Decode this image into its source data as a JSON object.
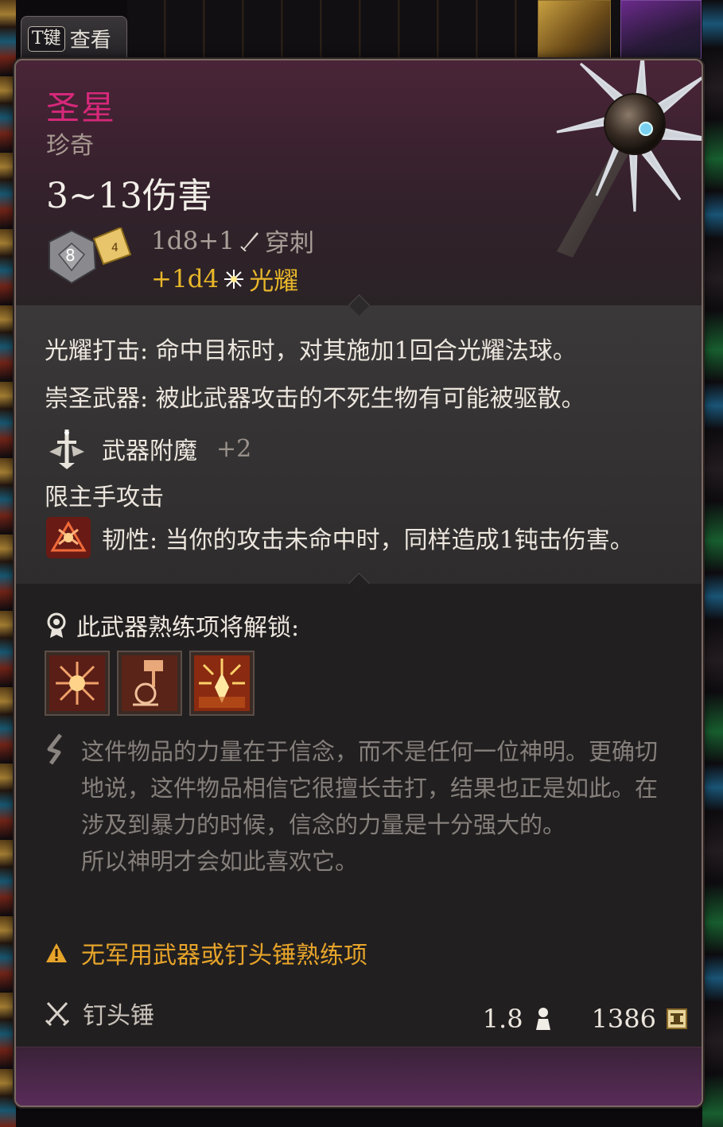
{
  "inspect_tab": {
    "key": "T键",
    "label": "查看"
  },
  "item": {
    "name": "圣星",
    "rarity": "珍奇",
    "damage_range": "3~13伤害",
    "damage": [
      {
        "dice": "1d8+1",
        "icon": "piercing-icon",
        "type": "穿刺"
      },
      {
        "dice": "+1d4",
        "icon": "radiant-icon",
        "type": "光耀"
      }
    ],
    "dice_icon": {
      "d8_label": "8",
      "d4_label": "4"
    },
    "effects": [
      "光耀打击: 命中目标时，对其施加1回合光耀法球。",
      "崇圣武器: 被此武器攻击的不死生物有可能被驱散。"
    ],
    "enchantment": {
      "label": "武器附魔",
      "value": "+2"
    },
    "main_hand": "限主手攻击",
    "resilience": "韧性: 当你的攻击未命中时，同样造成1钝击伤害。",
    "proficiency_unlock": "此武器熟练项将解锁:",
    "actions": [
      "action-icon-1",
      "action-icon-2",
      "action-icon-3"
    ],
    "lore": [
      "这件物品的力量在于信念，而不是任何一位神明。更确切地说，这件物品相信它很擅长击打，结果也正是如此。在涉及到暴力的时候，信念的力量是十分强大的。",
      "所以神明才会如此喜欢它。"
    ],
    "warning": "无军用武器或钉头锤熟练项",
    "weapon_type": "钉头锤",
    "weight": "1.8",
    "value": "1386"
  },
  "colors": {
    "name": "#d6287a",
    "radiant": "#e8b62a",
    "warning": "#e6a42a"
  }
}
